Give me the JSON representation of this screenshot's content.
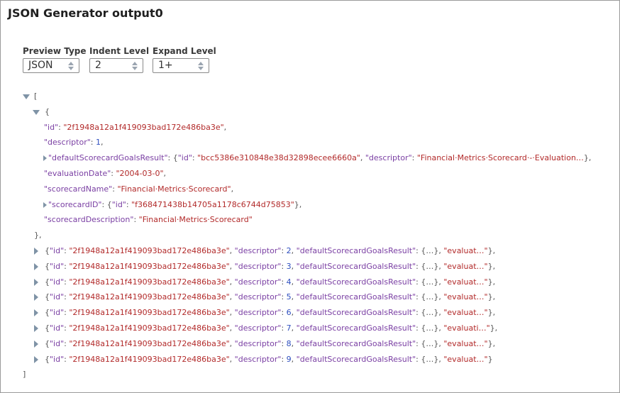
{
  "window": {
    "title": "JSON Generator output0"
  },
  "controls": {
    "preview_type": {
      "label": "Preview Type",
      "value": "JSON"
    },
    "indent_level": {
      "label": "Indent Level",
      "value": "2"
    },
    "expand_level": {
      "label": "Expand Level",
      "value": "1+"
    }
  },
  "tree": {
    "open_bracket": "[",
    "close_bracket": "]",
    "obj_open": "{",
    "obj_close": "},",
    "first": {
      "id_key": "\"id\"",
      "id_val": "\"2f1948a12a1f419093bad172e486ba3e\"",
      "descriptor_key": "\"descriptor\"",
      "descriptor_val": "1",
      "dsgr_key": "\"defaultScorecardGoalsResult\"",
      "dsgr_id_key": "\"id\"",
      "dsgr_id_val": "\"bcc5386e310848e38d32898ecee6660a\"",
      "dsgr_desc_key": "\"descriptor\"",
      "dsgr_desc_val": "\"Financial·Metrics·Scorecard·-·Evaluation…",
      "eval_key": "\"evaluationDate\"",
      "eval_val": "\"2004-03-0\"",
      "name_key": "\"scorecardName\"",
      "name_val": "\"Financial·Metrics·Scorecard\"",
      "sid_key": "\"scorecardID\"",
      "sid_id_key": "\"id\"",
      "sid_id_val": "\"f368471438b14705a1178c6744d75853\"",
      "sdesc_key": "\"scorecardDescription\"",
      "sdesc_val": "\"Financial·Metrics·Scorecard\""
    },
    "rows": [
      {
        "id": "\"2f1948a12a1f419093bad172e486ba3e\"",
        "descriptor": "2",
        "tail": "\"evaluat…\"",
        "end": "},"
      },
      {
        "id": "\"2f1948a12a1f419093bad172e486ba3e\"",
        "descriptor": "3",
        "tail": "\"evaluat…\"",
        "end": "},"
      },
      {
        "id": "\"2f1948a12a1f419093bad172e486ba3e\"",
        "descriptor": "4",
        "tail": "\"evaluat…\"",
        "end": "},"
      },
      {
        "id": "\"2f1948a12a1f419093bad172e486ba3e\"",
        "descriptor": "5",
        "tail": "\"evaluat…\"",
        "end": "},"
      },
      {
        "id": "\"2f1948a12a1f419093bad172e486ba3e\"",
        "descriptor": "6",
        "tail": "\"evaluat…\"",
        "end": "},"
      },
      {
        "id": "\"2f1948a12a1f419093bad172e486ba3e\"",
        "descriptor": "7",
        "tail": "\"evaluati…\"",
        "end": "},"
      },
      {
        "id": "\"2f1948a12a1f419093bad172e486ba3e\"",
        "descriptor": "8",
        "tail": "\"evaluat…\"",
        "end": "},"
      },
      {
        "id": "\"2f1948a12a1f419093bad172e486ba3e\"",
        "descriptor": "9",
        "tail": "\"evaluat…\"",
        "end": "}"
      }
    ],
    "row_labels": {
      "id_key": "\"id\"",
      "descriptor_key": "\"descriptor\"",
      "dsgr_key": "\"defaultScorecardGoalsResult\"",
      "collapsed": "{…}"
    }
  },
  "colors": {
    "key": "#7a3fa3",
    "string": "#b22a2a",
    "number": "#2f4fbf",
    "toggle": "#7f93a6"
  },
  "icons": {
    "expand": "triangle-down-icon",
    "collapse": "triangle-right-icon",
    "stepper": "stepper-arrows-icon"
  }
}
